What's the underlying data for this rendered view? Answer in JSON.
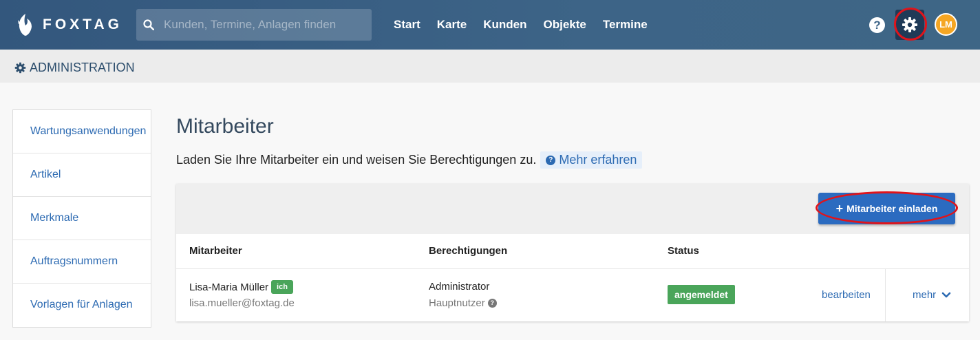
{
  "app": {
    "brand": "FOXTAG"
  },
  "search": {
    "placeholder": "Kunden, Termine, Anlagen finden"
  },
  "nav": {
    "items": [
      "Start",
      "Karte",
      "Kunden",
      "Objekte",
      "Termine"
    ]
  },
  "user": {
    "initials": "LM"
  },
  "help": {
    "label": "?"
  },
  "admin": {
    "title": "ADMINISTRATION"
  },
  "sidebar": {
    "items": [
      "Wartungsanwendungen",
      "Artikel",
      "Merkmale",
      "Auftragsnummern",
      "Vorlagen für Anlagen"
    ]
  },
  "main": {
    "title": "Mitarbeiter",
    "intro": "Laden Sie Ihre Mitarbeiter ein und weisen Sie Berechtigungen zu.",
    "learn_more": "Mehr erfahren",
    "invite_label": "Mitarbeiter einladen",
    "invite_plus": "+"
  },
  "table": {
    "headers": [
      "Mitarbeiter",
      "Berechtigungen",
      "Status"
    ],
    "rows": [
      {
        "name": "Lisa-Maria Müller",
        "badge": "ich",
        "email": "lisa.mueller@foxtag.de",
        "role": "Administrator",
        "role_sub": "Hauptnutzer",
        "status": "angemeldet",
        "edit": "bearbeiten",
        "more": "mehr"
      }
    ]
  },
  "colors": {
    "accent": "#2b6bc0",
    "success": "#4aa55a",
    "topbar": "#3d6487",
    "avatar": "#f5a623",
    "highlight": "#e0141b"
  }
}
